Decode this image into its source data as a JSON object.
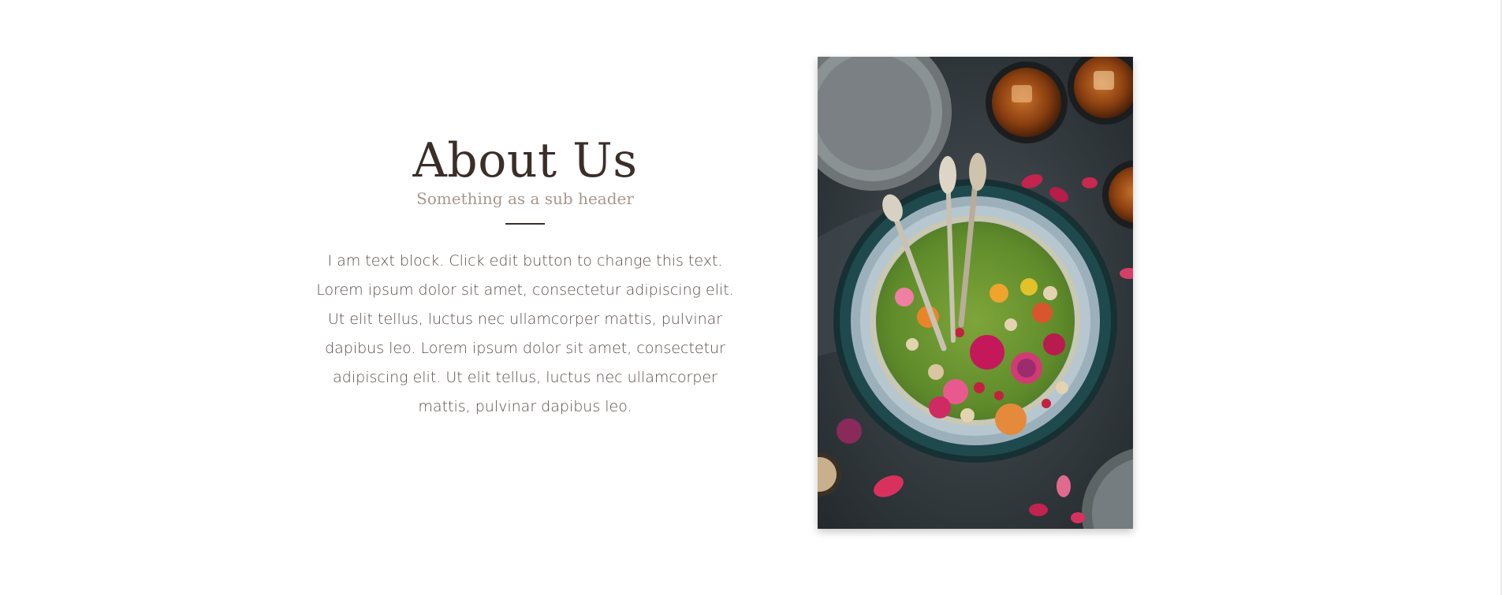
{
  "about": {
    "title": "About Us",
    "subtitle": "Something as a sub header",
    "body": "I am text block. Click edit button to change this text. Lorem ipsum dolor sit amet, consectetur adipiscing elit. Ut elit tellus, luctus nec ullamcorper mattis, pulvinar dapibus leo. Lorem ipsum dolor sit amet, consectetur adipiscing elit. Ut elit tellus, luctus nec ullamcorper mattis, pulvinar dapibus leo."
  },
  "photo": {
    "icon": "food-photo-image"
  },
  "colors": {
    "title": "#3b2e29",
    "subtitle": "#a9978c",
    "body": "#5a4f4a"
  }
}
